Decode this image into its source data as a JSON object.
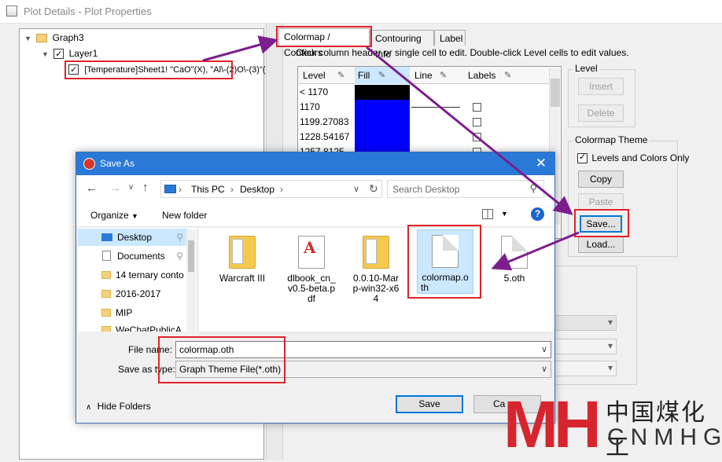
{
  "window": {
    "title": "Plot Details - Plot Properties"
  },
  "tree": {
    "graph": "Graph3",
    "layer": "Layer1",
    "dataset": "[Temperature]Sheet1! \"CaO\"(X), \"Al\\-(2)O\\-(3)\"("
  },
  "tabs": [
    {
      "label": "Colormap / Contours"
    },
    {
      "label": "Contouring Info"
    },
    {
      "label": "Label"
    }
  ],
  "hint": "Click column header or single cell to edit. Double-click Level cells to edit values.",
  "levels_table": {
    "headers": [
      "Level",
      "Fill",
      "Line",
      "Labels"
    ],
    "rows": [
      {
        "level": "< 1170",
        "fill": "#000000",
        "line": false,
        "label": false
      },
      {
        "level": "1170",
        "fill": "#0000ff",
        "line": true,
        "label": true
      },
      {
        "level": "1199.27083",
        "fill": "#0000ff",
        "line": false,
        "label": true
      },
      {
        "level": "1228.54167",
        "fill": "#0000ff",
        "line": false,
        "label": true
      },
      {
        "level": "1257.8125",
        "fill": "#0000ff",
        "line": false,
        "label": true
      }
    ]
  },
  "level_group": {
    "title": "Level",
    "insert": "Insert",
    "delete": "Delete"
  },
  "colormap_theme": {
    "title": "Colormap Theme",
    "levels_only": "Levels and Colors Only",
    "copy": "Copy",
    "paste": "Paste",
    "save": "Save...",
    "load": "Load..."
  },
  "save_as": {
    "title": "Save As",
    "address": [
      "This PC",
      "Desktop"
    ],
    "search_placeholder": "Search Desktop",
    "organize": "Organize",
    "new_folder": "New folder",
    "help": "?",
    "nav_items": [
      {
        "label": "Desktop"
      },
      {
        "label": "Documents"
      },
      {
        "label": "14 ternary conto"
      },
      {
        "label": "2016-2017"
      },
      {
        "label": "MIP"
      },
      {
        "label": "WeChatPublicA"
      }
    ],
    "files": [
      {
        "name": "Warcraft III",
        "type": "folder"
      },
      {
        "name": "dlbook_cn_v0.5-beta.pdf",
        "line1": "dlbook_cn_",
        "line2": "v0.5-beta.p",
        "line3": "df",
        "type": "pdf"
      },
      {
        "name": "0.0.10-Mar-win32-x64",
        "line1": "0.0.10-Mar",
        "line2": "p-win32-x6",
        "line3": "4",
        "type": "folder"
      },
      {
        "name": "colormap.oth",
        "line1": "colormap.o",
        "line2": "th",
        "type": "doc"
      },
      {
        "name": "5.oth",
        "type": "doc"
      }
    ],
    "file_name_label": "File name:",
    "file_name_value": "colormap.oth",
    "save_type_label": "Save as type:",
    "save_type_value": "Graph Theme File(*.oth)",
    "hide_folders": "Hide Folders",
    "save_button": "Save",
    "cancel_button": "Ca"
  },
  "watermark": {
    "logo": "MH",
    "chinese": "中国煤化工",
    "latin": "CNMHG"
  },
  "colors": {
    "accent": "#2b79d6",
    "highlight": "#e0232c",
    "arrow": "#7b1f8c",
    "fill_blue": "#0000ff"
  }
}
